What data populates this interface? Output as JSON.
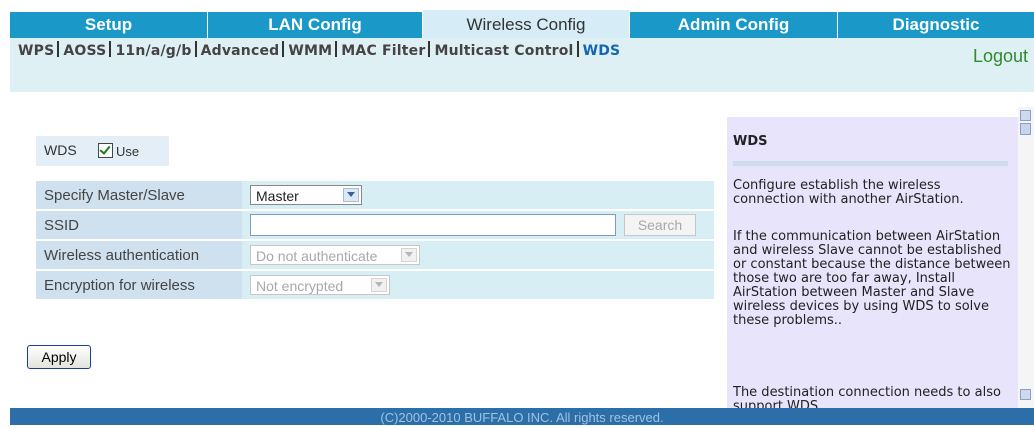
{
  "tabs": [
    "Setup",
    "LAN Config",
    "Wireless Config",
    "Admin Config",
    "Diagnostic"
  ],
  "active_tab": "Wireless Config",
  "subnav": {
    "links": [
      "WPS",
      "AOSS",
      "11n/a/g/b",
      "Advanced",
      "WMM",
      "MAC Filter",
      "Multicast Control",
      "WDS"
    ],
    "active": "WDS"
  },
  "logout": "Logout",
  "form": {
    "wds_label": "WDS",
    "use_label": "Use",
    "use_checked": true,
    "rows": [
      {
        "label": "Specify Master/Slave",
        "value": "Master"
      },
      {
        "label": "SSID",
        "value": "",
        "button": "Search"
      },
      {
        "label": "Wireless authentication",
        "value": "Do not authenticate"
      },
      {
        "label": "Encryption for wireless",
        "value": "Not encrypted"
      }
    ],
    "apply": "Apply"
  },
  "help": {
    "title": "WDS",
    "paragraphs": [
      "Configure establish the wireless connection with another AirStation.",
      "If the communication between AirStation and wireless Slave cannot be established or constant because the distance between those two are too far away, Install AirStation between Master and Slave wireless devices by using WDS to solve these problems..",
      "The destination connection needs to also support WDS."
    ]
  },
  "footer": "(C)2000-2010 BUFFALO INC. All rights reserved.",
  "colors": {
    "tab_bar": "#1a98c8",
    "active_tab": "#d6ecf6",
    "footer": "#2b6ea8",
    "help_bg": "#e7e4fb"
  }
}
